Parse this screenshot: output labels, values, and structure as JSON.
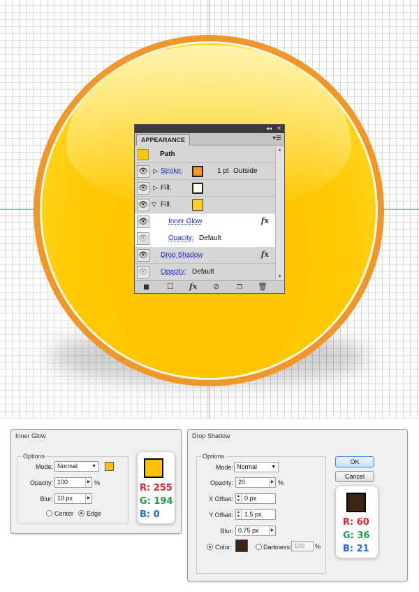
{
  "appearance_panel": {
    "tab_label": "APPEARANCE",
    "collapse_glyph": "◂◂",
    "close_glyph": "✕",
    "menu_glyph": "▾☰",
    "rows": {
      "path": {
        "label": "Path",
        "swatch_color": "#ffc800"
      },
      "stroke": {
        "label": "Stroke:",
        "swatch_color": "#f0962a",
        "weight": "1 pt",
        "align": "Outside"
      },
      "fill1": {
        "label": "Fill:",
        "swatch_color": "#fffbe6"
      },
      "fill2": {
        "label": "Fill:",
        "swatch_color": "#ffd11a"
      },
      "inner_glow": {
        "label": "Inner Glow"
      },
      "inner_opacity": {
        "label": "Opacity:",
        "value": "Default"
      },
      "drop_shadow": {
        "label": "Drop Shadow"
      },
      "opacity": {
        "label": "Opacity:",
        "value": "Default"
      }
    },
    "fx_glyph": "fx"
  },
  "inner_glow_dialog": {
    "title": "Inner Glow",
    "options_label": "Options",
    "mode_label": "Mode:",
    "mode_value": "Normal",
    "opacity_label": "Opacity:",
    "opacity_value": "100",
    "opacity_unit": "%",
    "blur_label": "Blur:",
    "blur_value": "10 px",
    "center_label": "Center",
    "edge_label": "Edge",
    "color_swatch": "#ffc200",
    "rgb": {
      "r": "R: 255",
      "g": "G: 194",
      "b": "B: 0"
    }
  },
  "drop_shadow_dialog": {
    "title": "Drop Shadow",
    "options_label": "Options",
    "mode_label": "Mode:",
    "mode_value": "Normal",
    "opacity_label": "Opacity:",
    "opacity_value": "20",
    "opacity_unit": "%",
    "x_offset_label": "X Offset:",
    "x_offset_value": "0 px",
    "y_offset_label": "Y Offset:",
    "y_offset_value": "1.5 px",
    "blur_label": "Blur:",
    "blur_value": "0.75 px",
    "color_label": "Color:",
    "color_swatch": "#3c2415",
    "darkness_label": "Darkness:",
    "darkness_value": "100",
    "darkness_unit": "%",
    "ok_label": "OK",
    "cancel_label": "Cancel",
    "rgb": {
      "r": "R: 60",
      "g": "G: 36",
      "b": "B: 21"
    }
  }
}
